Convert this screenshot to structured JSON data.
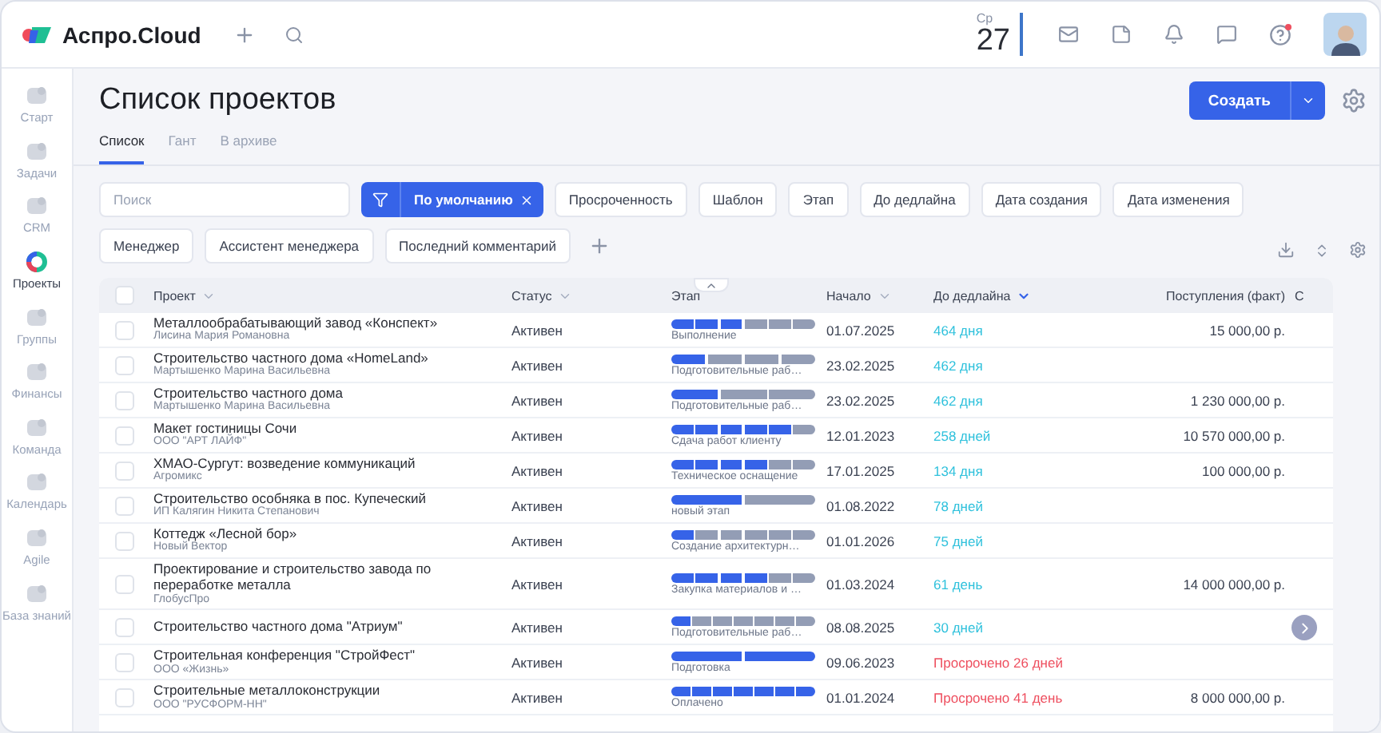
{
  "brand": "Аспро.Cloud",
  "date": {
    "weekday": "Ср",
    "day": "27"
  },
  "help_unread": true,
  "sidebar": {
    "items": [
      {
        "label": "Старт",
        "selected": false
      },
      {
        "label": "Задачи",
        "selected": false
      },
      {
        "label": "CRM",
        "selected": false
      },
      {
        "label": "Проекты",
        "selected": true
      },
      {
        "label": "Группы",
        "selected": false
      },
      {
        "label": "Финансы",
        "selected": false
      },
      {
        "label": "Команда",
        "selected": false
      },
      {
        "label": "Календарь",
        "selected": false
      },
      {
        "label": "Agile",
        "selected": false
      },
      {
        "label": "База знаний",
        "selected": false
      }
    ]
  },
  "page_title": "Список проектов",
  "create_button": "Создать",
  "tabs": [
    {
      "label": "Список",
      "selected": true
    },
    {
      "label": "Гант",
      "selected": false
    },
    {
      "label": "В архиве",
      "selected": false
    }
  ],
  "search": {
    "placeholder": "Поиск"
  },
  "preset_filter": "По умолчанию",
  "filters": [
    "Просроченность",
    "Шаблон",
    "Этап",
    "До дедлайна",
    "Дата создания",
    "Дата изменения",
    "Менеджер",
    "Ассистент менеджера",
    "Последний комментарий"
  ],
  "table": {
    "select_all_checked": false,
    "columns": [
      {
        "label": "Проект",
        "sorted": false
      },
      {
        "label": "Статус",
        "sorted": false
      },
      {
        "label": "Этап"
      },
      {
        "label": "Начало",
        "sorted": false
      },
      {
        "label": "До дедлайна",
        "sorted": true
      },
      {
        "label": "Поступления (факт)"
      },
      {
        "label": "С"
      }
    ],
    "rows": [
      {
        "checked": false,
        "project": "Металлообрабатывающий завод «Конспект»",
        "client": "Лисина Мария Романовна",
        "status": "Активен",
        "stage": {
          "name": "Выполнение",
          "segments": [
            {
              "done": true
            },
            {
              "done": true
            },
            {
              "done": true
            },
            {
              "done": false
            },
            {
              "done": false
            },
            {
              "done": false
            }
          ]
        },
        "start": "01.07.2025",
        "deadline": "464 дня",
        "overdue": false,
        "revenue": "15 000,00 р."
      },
      {
        "checked": false,
        "project": "Строительство частного дома «HomeLand»",
        "client": "Мартышенко Марина Васильевна",
        "status": "Активен",
        "stage": {
          "name": "Подготовительные раб…",
          "segments": [
            {
              "done": true
            },
            {
              "done": false
            },
            {
              "done": false
            },
            {
              "done": false
            }
          ]
        },
        "start": "23.02.2025",
        "deadline": "462 дня",
        "overdue": false,
        "revenue": ""
      },
      {
        "checked": false,
        "project": "Строительство частного дома",
        "client": "Мартышенко Марина Васильевна",
        "status": "Активен",
        "stage": {
          "name": "Подготовительные раб…",
          "segments": [
            {
              "done": true
            },
            {
              "done": false
            },
            {
              "done": false
            }
          ]
        },
        "start": "23.02.2025",
        "deadline": "462 дня",
        "overdue": false,
        "revenue": "1 230 000,00 р."
      },
      {
        "checked": false,
        "project": "Макет гостиницы Сочи",
        "client": "ООО \"АРТ ЛАЙФ\"",
        "status": "Активен",
        "stage": {
          "name": "Сдача работ клиенту",
          "segments": [
            {
              "done": true
            },
            {
              "done": true
            },
            {
              "done": true
            },
            {
              "done": true
            },
            {
              "done": true
            },
            {
              "done": false
            }
          ]
        },
        "start": "12.01.2023",
        "deadline": "258 дней",
        "overdue": false,
        "revenue": "10 570 000,00 р."
      },
      {
        "checked": false,
        "project": "ХМАО-Сургут: возведение коммуникаций",
        "client": "Агромикс",
        "status": "Активен",
        "stage": {
          "name": "Техническое оснащение",
          "segments": [
            {
              "done": true
            },
            {
              "done": true
            },
            {
              "done": true
            },
            {
              "done": true
            },
            {
              "done": false
            },
            {
              "done": false
            }
          ]
        },
        "start": "17.01.2025",
        "deadline": "134 дня",
        "overdue": false,
        "revenue": "100 000,00 р."
      },
      {
        "checked": false,
        "project": "Строительство особняка в пос. Купеческий",
        "client": "ИП Калягин Никита Степанович",
        "status": "Активен",
        "stage": {
          "name": "новый этап",
          "segments": [
            {
              "done": true
            },
            {
              "done": false
            }
          ]
        },
        "start": "01.08.2022",
        "deadline": "78 дней",
        "overdue": false,
        "revenue": ""
      },
      {
        "checked": false,
        "project": "Коттедж «Лесной бор»",
        "client": "Новый Вектор",
        "status": "Активен",
        "stage": {
          "name": "Создание архитектурн…",
          "segments": [
            {
              "done": true
            },
            {
              "done": false
            },
            {
              "done": false
            },
            {
              "done": false
            },
            {
              "done": false
            },
            {
              "done": false
            }
          ]
        },
        "start": "01.01.2026",
        "deadline": "75 дней",
        "overdue": false,
        "revenue": ""
      },
      {
        "checked": false,
        "project": "Проектирование и строительство завода по переработке металла",
        "client": "ГлобусПро",
        "status": "Активен",
        "stage": {
          "name": "Закупка материалов и …",
          "segments": [
            {
              "done": true
            },
            {
              "done": true
            },
            {
              "done": true
            },
            {
              "done": true
            },
            {
              "done": false
            },
            {
              "done": false
            }
          ]
        },
        "start": "01.03.2024",
        "deadline": "61 день",
        "overdue": false,
        "revenue": "14 000 000,00 р."
      },
      {
        "checked": false,
        "project": "Строительство частного дома \"Атриум\"",
        "client": "",
        "status": "Активен",
        "stage": {
          "name": "Подготовительные раб…",
          "segments": [
            {
              "done": true
            },
            {
              "done": false
            },
            {
              "done": false
            },
            {
              "done": false
            },
            {
              "done": false
            },
            {
              "done": false
            },
            {
              "done": false
            }
          ]
        },
        "start": "08.08.2025",
        "deadline": "30 дней",
        "overdue": false,
        "revenue": ""
      },
      {
        "checked": false,
        "project": "Строительная конференция \"СтройФест\"",
        "client": "ООО «Жизнь»",
        "status": "Активен",
        "stage": {
          "name": "Подготовка",
          "segments": [
            {
              "done": true
            },
            {
              "done": true
            }
          ]
        },
        "start": "09.06.2023",
        "deadline": "Просрочено 26 дней",
        "overdue": true,
        "revenue": ""
      },
      {
        "checked": false,
        "project": "Строительные металлоконструкции",
        "client": "ООО \"РУСФОРМ-НН\"",
        "status": "Активен",
        "stage": {
          "name": "Оплачено",
          "segments": [
            {
              "done": true
            },
            {
              "done": true
            },
            {
              "done": true
            },
            {
              "done": true
            },
            {
              "done": true
            },
            {
              "done": true
            },
            {
              "done": true
            }
          ]
        },
        "start": "01.01.2024",
        "deadline": "Просрочено 41 день",
        "overdue": true,
        "revenue": "8 000 000,00 р."
      }
    ]
  }
}
